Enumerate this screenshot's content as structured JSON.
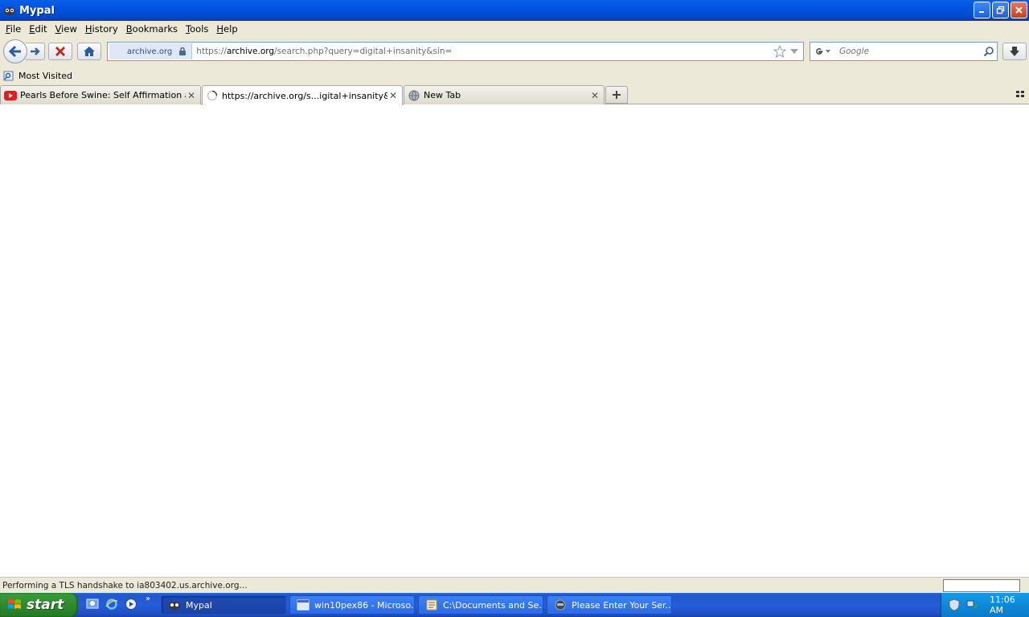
{
  "window": {
    "title": "Mypal"
  },
  "menu": [
    {
      "label": "File",
      "key": "F",
      "rest": "ile"
    },
    {
      "label": "Edit",
      "key": "E",
      "rest": "dit"
    },
    {
      "label": "View",
      "key": "V",
      "rest": "iew"
    },
    {
      "label": "History",
      "key": "H",
      "rest": "istory"
    },
    {
      "label": "Bookmarks",
      "key": "B",
      "rest": "ookmarks"
    },
    {
      "label": "Tools",
      "key": "T",
      "rest": "ools"
    },
    {
      "label": "Help",
      "key": "H",
      "rest": "elp"
    }
  ],
  "urlbar": {
    "identity": "archive.org",
    "prefix": "https://",
    "host": "archive.org",
    "path": "/search.php?query=digital+insanity&sin="
  },
  "search": {
    "placeholder": "Google"
  },
  "bookmarks": {
    "most_visited": "Most Visited"
  },
  "tabs": [
    {
      "label": "Pearls Before Swine: Self Affirmation and...",
      "icon": "youtube-icon",
      "active": false
    },
    {
      "label": "https://archive.org/s...igital+insanity&sin=",
      "icon": "loading-throbber-icon",
      "active": true
    },
    {
      "label": "New Tab",
      "icon": "globe-icon",
      "active": false
    }
  ],
  "status": {
    "text": "Performing a TLS handshake to ia803402.us.archive.org..."
  },
  "taskbar": {
    "start_label": "start",
    "tasks": [
      {
        "label": "Mypal",
        "active": true
      },
      {
        "label": "win10pex86 - Microso...",
        "active": false
      },
      {
        "label": "C:\\Documents and Se...",
        "active": false
      },
      {
        "label": "Please Enter Your Ser...",
        "active": false
      }
    ],
    "clock": "11:06 AM"
  },
  "colors": {
    "titlebar": "#0053e1",
    "start": "#2f8a2f",
    "taskbar": "#245edb",
    "tray": "#0f8ad8"
  }
}
